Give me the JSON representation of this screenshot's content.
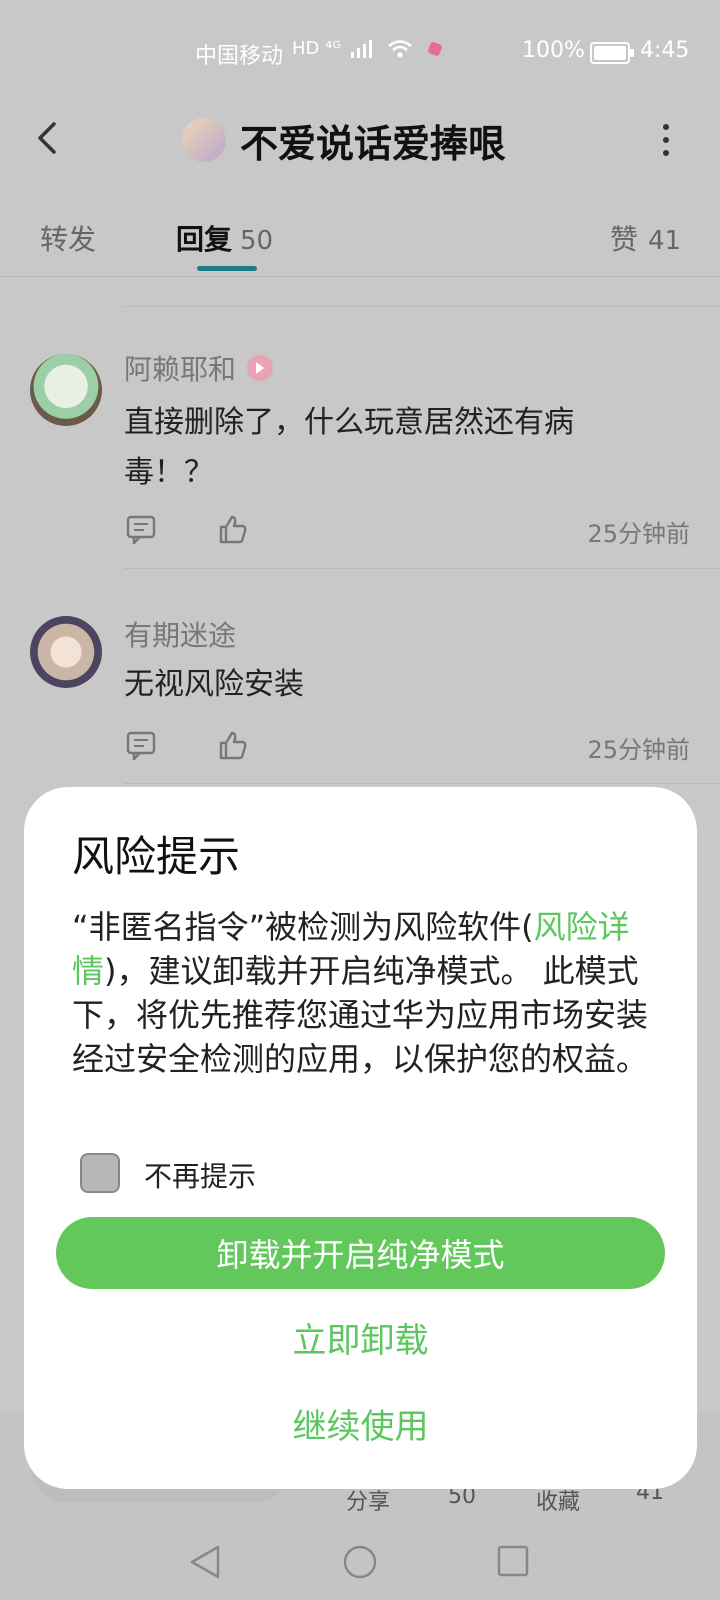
{
  "status_bar": {
    "carrier": "中国移动",
    "network": "HD ⁴ᴳ",
    "battery": "100%",
    "time": "4:45"
  },
  "header": {
    "title": "不爱说话爱捧哏",
    "back_icon": "chevron-left-icon",
    "more_icon": "more-vertical-icon"
  },
  "tabs": {
    "forward": "转发",
    "reply": "回复",
    "reply_count": "50",
    "like": "赞",
    "like_count": "41"
  },
  "comments": [
    {
      "name": "阿赖耶和",
      "text": "直接删除了，什么玩意居然还有病毒！？",
      "time": "25分钟前"
    },
    {
      "name": "有期迷途",
      "text": "无视风险安装",
      "time": "25分钟前"
    }
  ],
  "bottom_bar": {
    "share": "分享",
    "share_count": "50",
    "favorite": "收藏",
    "favorite_count": "41"
  },
  "dialog": {
    "title": "风险提示",
    "body_part1": "“非匿名指令”被检测为风险软件(",
    "body_link": "风险详情",
    "body_part2": ")，建议卸载并开启纯净模式。 此模式下，将优先推荐您通过华为应用市场安装经过安全检测的应用，以保护您的权益。",
    "checkbox_label": "不再提示",
    "primary_button": "卸载并开启纯净模式",
    "uninstall_button": "立即卸载",
    "continue_button": "继续使用",
    "accent": "#5cc65f"
  }
}
